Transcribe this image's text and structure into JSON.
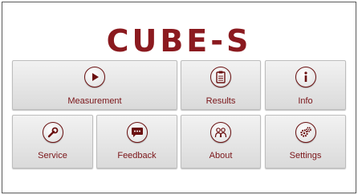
{
  "app": {
    "logo_text": "CUBE-S",
    "brand_color": "#8b1a1f"
  },
  "menu": {
    "measurement": {
      "label": "Measurement",
      "icon": "play-icon"
    },
    "results": {
      "label": "Results",
      "icon": "clipboard-icon"
    },
    "info": {
      "label": "Info",
      "icon": "info-icon"
    },
    "service": {
      "label": "Service",
      "icon": "wrench-icon"
    },
    "feedback": {
      "label": "Feedback",
      "icon": "chat-bubble-icon"
    },
    "about": {
      "label": "About",
      "icon": "people-icon"
    },
    "settings": {
      "label": "Settings",
      "icon": "gears-icon"
    }
  }
}
